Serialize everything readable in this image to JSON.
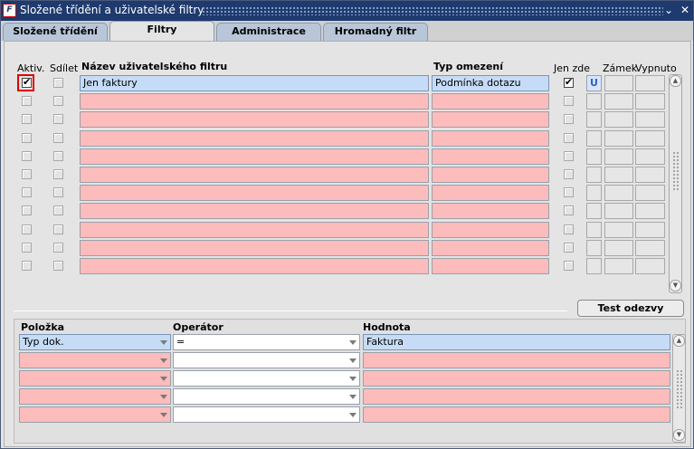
{
  "window": {
    "title": "Složené třídění a uživatelské filtry",
    "minimize": "⌄",
    "close": "✕",
    "app_icon": "oracle-forms-icon"
  },
  "tabs": [
    {
      "label": "Složené třídění",
      "active": false
    },
    {
      "label": "Filtry",
      "active": true
    },
    {
      "label": "Administrace filtrů",
      "active": false
    },
    {
      "label": "Hromadný filtr",
      "active": false
    }
  ],
  "filters": {
    "headers": {
      "aktiv": "Aktiv.",
      "sdilet": "Sdílet",
      "nazev": "Název uživatelského filtru",
      "typ": "Typ omezení",
      "jen_zde": "Jen zde",
      "zamek": "Zámek",
      "vypnuto": "Vypnuto"
    },
    "rows": [
      {
        "aktiv": true,
        "sdilet": false,
        "nazev": "Jen faktury",
        "typ": "Podmínka dotazu",
        "jen_zde": true,
        "u": "U"
      },
      {
        "aktiv": false,
        "sdilet": false,
        "nazev": "",
        "typ": "",
        "jen_zde": false,
        "u": ""
      },
      {
        "aktiv": false,
        "sdilet": false,
        "nazev": "",
        "typ": "",
        "jen_zde": false,
        "u": ""
      },
      {
        "aktiv": false,
        "sdilet": false,
        "nazev": "",
        "typ": "",
        "jen_zde": false,
        "u": ""
      },
      {
        "aktiv": false,
        "sdilet": false,
        "nazev": "",
        "typ": "",
        "jen_zde": false,
        "u": ""
      },
      {
        "aktiv": false,
        "sdilet": false,
        "nazev": "",
        "typ": "",
        "jen_zde": false,
        "u": ""
      },
      {
        "aktiv": false,
        "sdilet": false,
        "nazev": "",
        "typ": "",
        "jen_zde": false,
        "u": ""
      },
      {
        "aktiv": false,
        "sdilet": false,
        "nazev": "",
        "typ": "",
        "jen_zde": false,
        "u": ""
      },
      {
        "aktiv": false,
        "sdilet": false,
        "nazev": "",
        "typ": "",
        "jen_zde": false,
        "u": ""
      },
      {
        "aktiv": false,
        "sdilet": false,
        "nazev": "",
        "typ": "",
        "jen_zde": false,
        "u": ""
      },
      {
        "aktiv": false,
        "sdilet": false,
        "nazev": "",
        "typ": "",
        "jen_zde": false,
        "u": ""
      }
    ]
  },
  "test_button": "Test odezvy",
  "conditions": {
    "headers": {
      "polozka": "Položka",
      "operator": "Operátor",
      "hodnota": "Hodnota"
    },
    "rows": [
      {
        "polozka": "Typ  dok.",
        "operator": "=",
        "hodnota": "Faktura"
      },
      {
        "polozka": "",
        "operator": "",
        "hodnota": ""
      },
      {
        "polozka": "",
        "operator": "",
        "hodnota": ""
      },
      {
        "polozka": "",
        "operator": "",
        "hodnota": ""
      },
      {
        "polozka": "",
        "operator": "",
        "hodnota": ""
      }
    ]
  },
  "colors": {
    "title_bar": "#1e3a6e",
    "required_field": "#fcbcbc",
    "current_record": "#c6dcf6",
    "focus": "#e00000"
  }
}
